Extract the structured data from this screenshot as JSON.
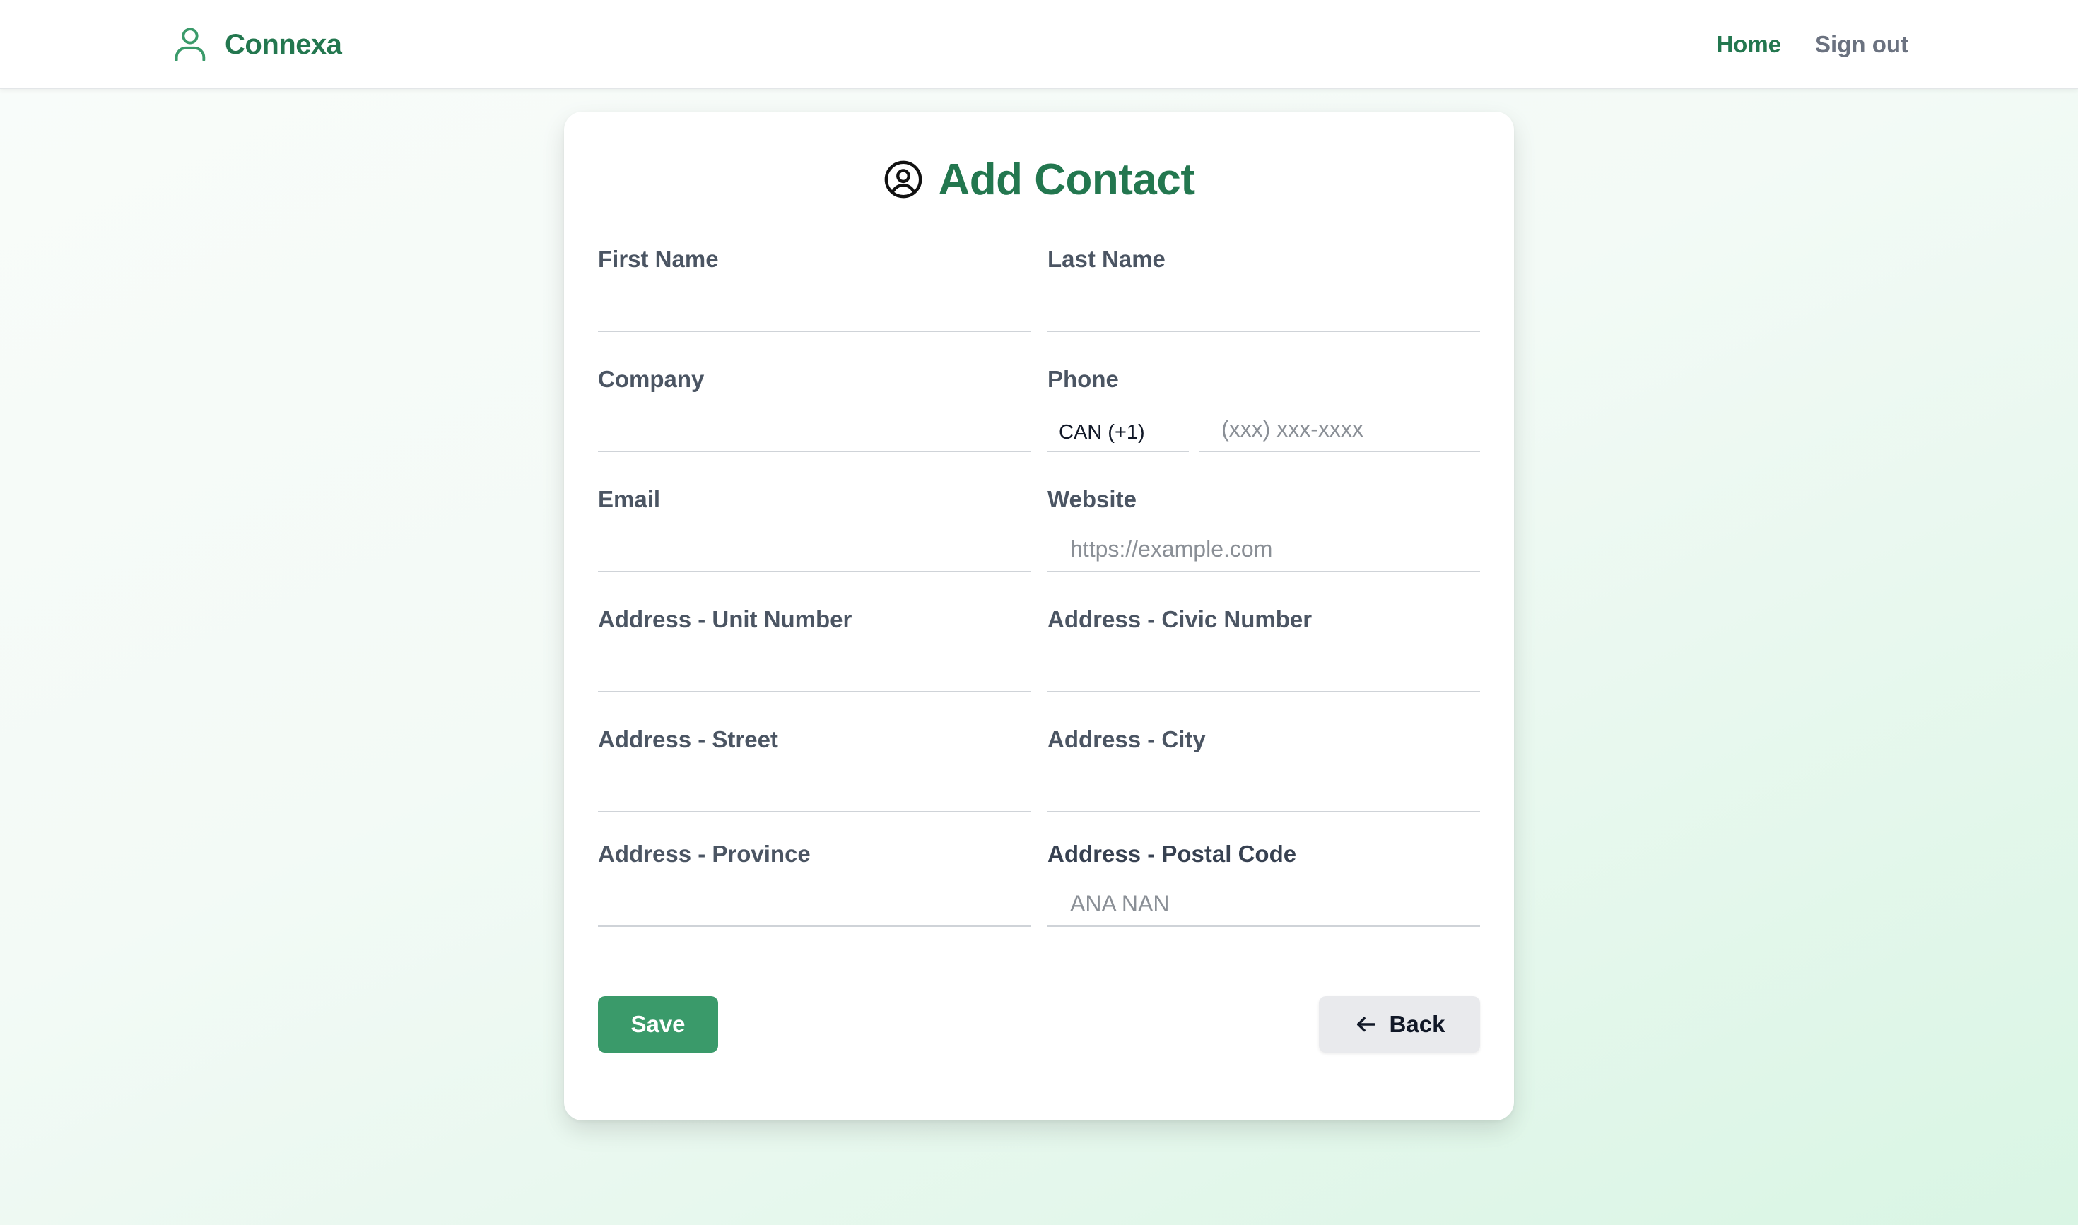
{
  "header": {
    "brand_name": "Connexa",
    "brand_icon": "user-icon",
    "nav": [
      {
        "label": "Home",
        "active": true
      },
      {
        "label": "Sign out",
        "active": false
      }
    ]
  },
  "form": {
    "title": "Add Contact",
    "title_icon": "user-circle-icon",
    "fields": {
      "first_name": {
        "label": "First Name",
        "value": "",
        "placeholder": ""
      },
      "last_name": {
        "label": "Last Name",
        "value": "",
        "placeholder": ""
      },
      "company": {
        "label": "Company",
        "value": "",
        "placeholder": ""
      },
      "phone": {
        "label": "Phone",
        "country_code": "CAN (+1)",
        "value": "",
        "placeholder": "(xxx) xxx-xxxx"
      },
      "email": {
        "label": "Email",
        "value": "",
        "placeholder": ""
      },
      "website": {
        "label": "Website",
        "value": "",
        "placeholder": "https://example.com"
      },
      "unit_number": {
        "label": "Address - Unit Number",
        "value": "",
        "placeholder": ""
      },
      "civic_number": {
        "label": "Address - Civic Number",
        "value": "",
        "placeholder": ""
      },
      "street": {
        "label": "Address - Street",
        "value": "",
        "placeholder": ""
      },
      "city": {
        "label": "Address - City",
        "value": "",
        "placeholder": ""
      },
      "province": {
        "label": "Address - Province",
        "value": "",
        "placeholder": ""
      },
      "postal_code": {
        "label": "Address - Postal Code",
        "value": "",
        "placeholder": "ANA NAN"
      }
    },
    "save_label": "Save",
    "back_label": "Back",
    "back_icon": "arrow-left-icon"
  },
  "colors": {
    "brand": "#23774f",
    "primary_button": "#3a9a6a",
    "secondary_button": "#e9eaed",
    "nav_inactive": "#6b7280"
  }
}
